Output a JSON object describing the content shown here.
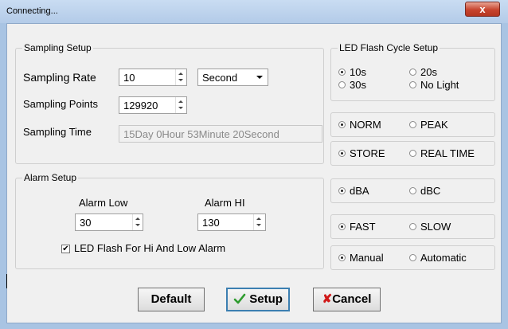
{
  "window": {
    "title": "Connecting...",
    "close_glyph": "x"
  },
  "sampling": {
    "legend": "Sampling Setup",
    "rate_label": "Sampling Rate",
    "rate_value": "10",
    "unit_value": "Second",
    "points_label": "Sampling Points",
    "points_value": "129920",
    "time_label": "Sampling Time",
    "time_value": "15Day 0Hour 53Minute 20Second"
  },
  "alarm": {
    "legend": "Alarm Setup",
    "low_label": "Alarm Low",
    "low_value": "30",
    "hi_label": "Alarm HI",
    "hi_value": "130",
    "led_label": "LED Flash For Hi And Low  Alarm",
    "led_checked": true
  },
  "led_flash": {
    "legend": "LED Flash Cycle Setup",
    "options": [
      "10s",
      "20s",
      "30s",
      "No Light"
    ],
    "selected": "10s"
  },
  "peak": {
    "options": [
      "NORM",
      "PEAK"
    ],
    "selected": "NORM"
  },
  "store": {
    "options": [
      "STORE",
      "REAL TIME"
    ],
    "selected": "STORE"
  },
  "weighting": {
    "options": [
      "dBA",
      "dBC"
    ],
    "selected": "dBA"
  },
  "response": {
    "options": [
      "FAST",
      "SLOW"
    ],
    "selected": "FAST"
  },
  "mode": {
    "options": [
      "Manual",
      "Automatic"
    ],
    "selected": "Manual"
  },
  "buttons": {
    "default": "Default",
    "setup": "Setup",
    "cancel": "Cancel"
  },
  "colors": {
    "check_green": "#2e9b2e",
    "cancel_red": "#d01818",
    "focus_blue": "#3c7fb1"
  },
  "icons": {
    "setup": "checkmark-icon",
    "cancel": "x-icon"
  }
}
